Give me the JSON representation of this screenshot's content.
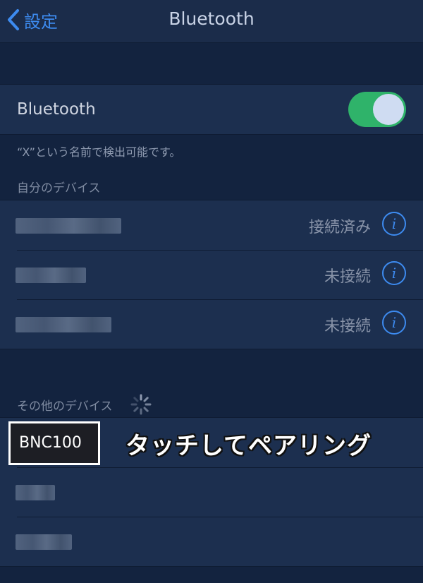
{
  "navbar": {
    "back_label": "設定",
    "title": "Bluetooth"
  },
  "bluetooth": {
    "label": "Bluetooth",
    "enabled": true,
    "note": "“X”という名前で検出可能です。"
  },
  "my_devices": {
    "header": "自分のデバイス",
    "items": [
      {
        "status": "接続済み"
      },
      {
        "status": "未接続"
      },
      {
        "status": "未接続"
      }
    ]
  },
  "other_devices": {
    "header": "その他のデバイス",
    "highlighted_device": "BNC100",
    "annotation": "タッチしてペアリング"
  },
  "colors": {
    "accent": "#3d8bf0",
    "toggle_on": "#2fb36a",
    "background": "#13233f"
  }
}
